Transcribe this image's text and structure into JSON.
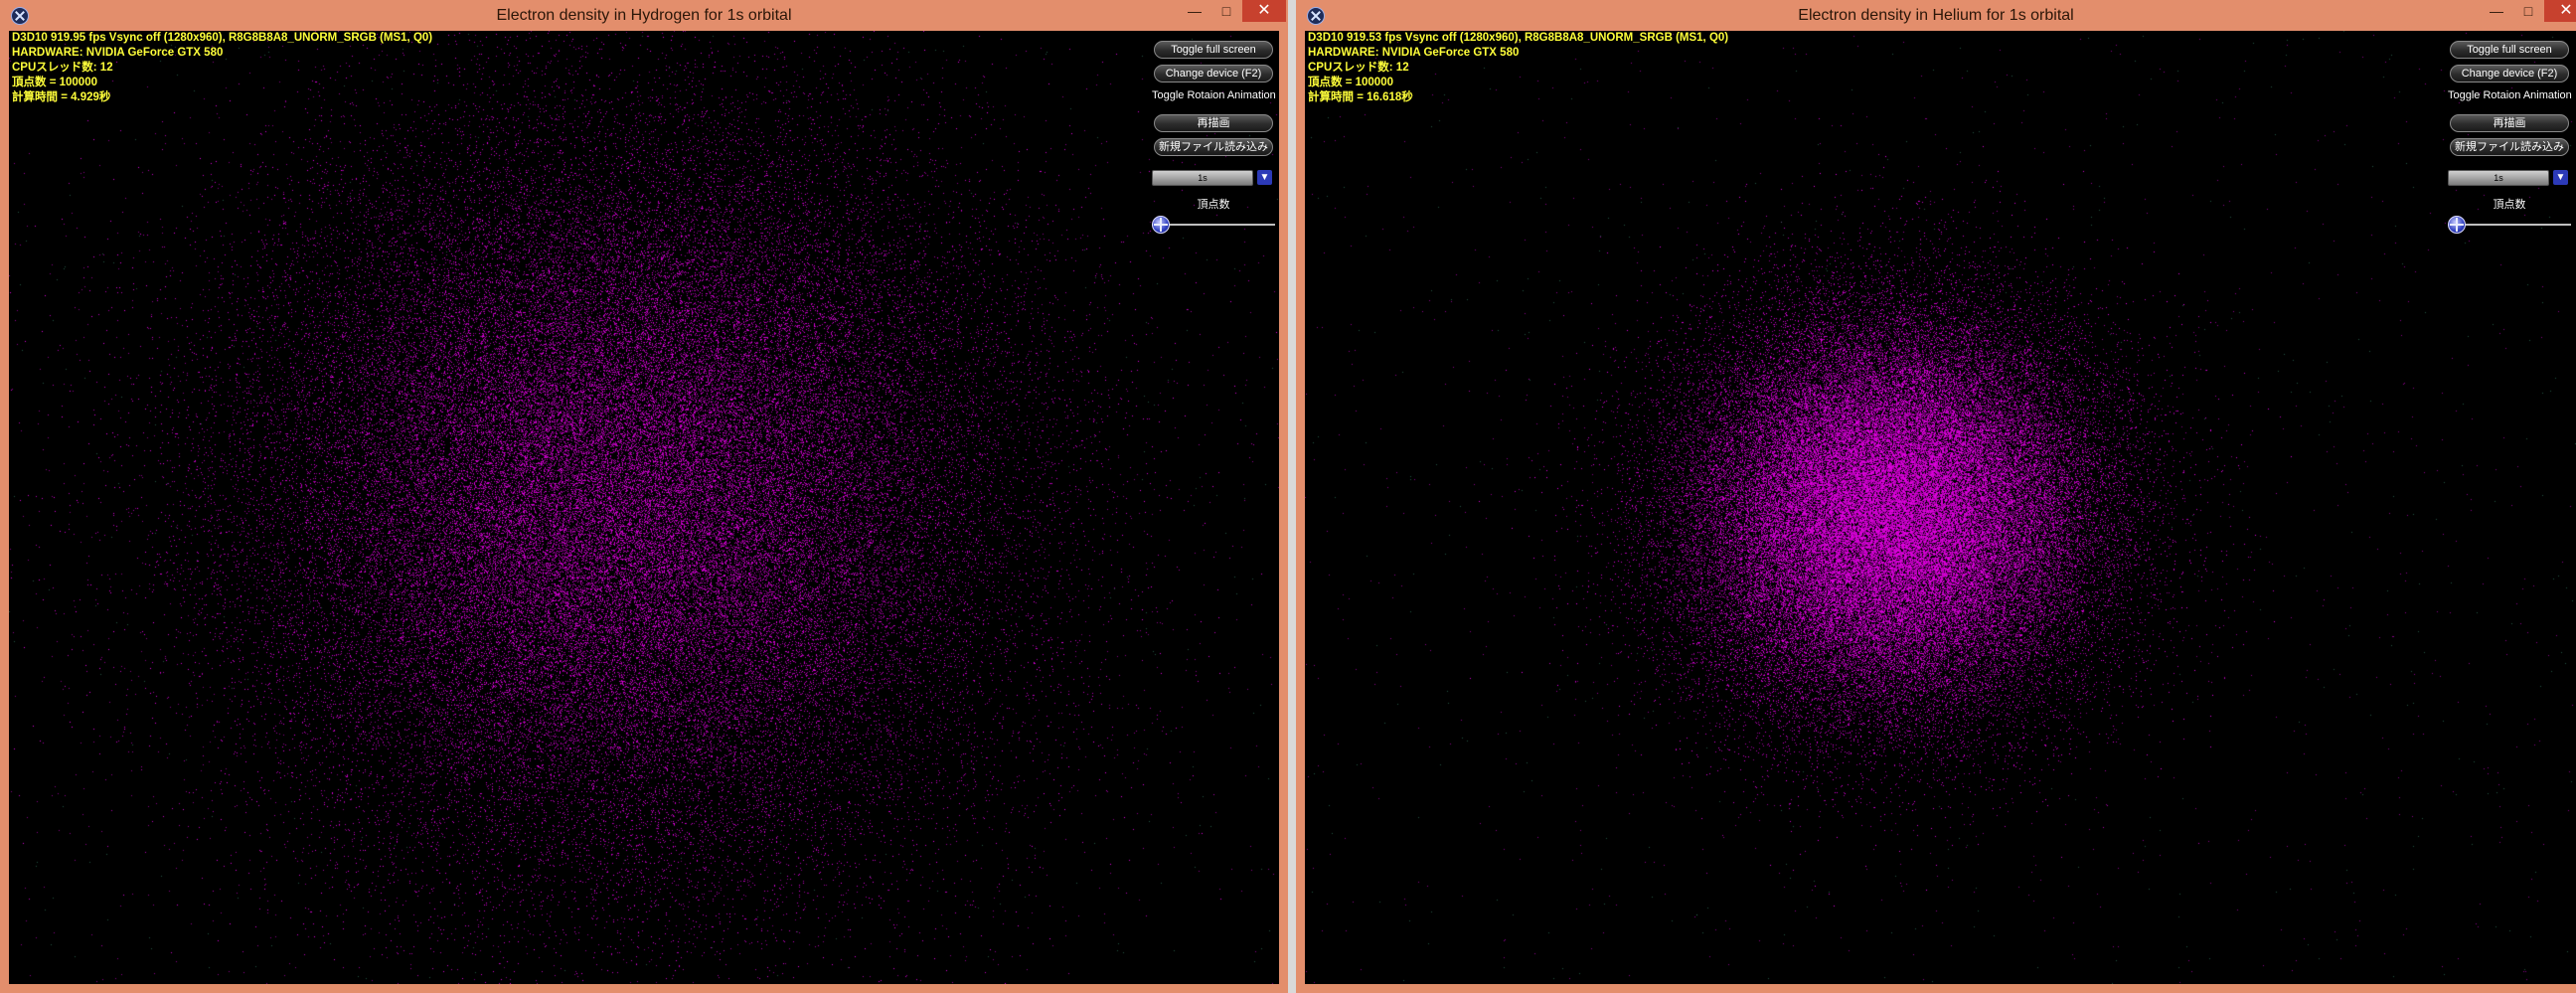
{
  "windows": [
    {
      "title": "Electron density in Hydrogen for 1s orbital",
      "controls": {
        "minimize": "—",
        "maximize": "□",
        "close": "✕"
      },
      "stats": {
        "line1": "D3D10 919.95 fps Vsync off (1280x960), R8G8B8A8_UNORM_SRGB (MS1, Q0)",
        "line2": "HARDWARE: NVIDIA GeForce GTX 580",
        "line3": "CPUスレッド数: 12",
        "line4": "頂点数 = 100000",
        "line5": "計算時間 = 4.929秒"
      },
      "panel": {
        "toggle_full_screen": "Toggle full screen",
        "change_device": "Change device (F2)",
        "toggle_rotation": "Toggle Rotaion Animation",
        "redraw": "再描画",
        "load_new_file": "新規ファイル読み込み",
        "orbital_selected": "1s",
        "vertex_count_label": "頂点数",
        "slider_value": 0.0
      },
      "visual": {
        "particle_color": "#e000e0",
        "spread": "wide"
      }
    },
    {
      "title": "Electron density in Helium for 1s orbital",
      "controls": {
        "minimize": "—",
        "maximize": "□",
        "close": "✕"
      },
      "stats": {
        "line1": "D3D10 919.53 fps Vsync off (1280x960), R8G8B8A8_UNORM_SRGB (MS1, Q0)",
        "line2": "HARDWARE: NVIDIA GeForce GTX 580",
        "line3": "CPUスレッド数: 12",
        "line4": "頂点数 = 100000",
        "line5": "計算時間 = 16.618秒"
      },
      "panel": {
        "toggle_full_screen": "Toggle full screen",
        "change_device": "Change device (F2)",
        "toggle_rotation": "Toggle Rotaion Animation",
        "redraw": "再描画",
        "load_new_file": "新規ファイル読み込み",
        "orbital_selected": "1s",
        "vertex_count_label": "頂点数",
        "slider_value": 0.0
      },
      "visual": {
        "particle_color": "#e000e0",
        "spread": "compact"
      }
    }
  ]
}
